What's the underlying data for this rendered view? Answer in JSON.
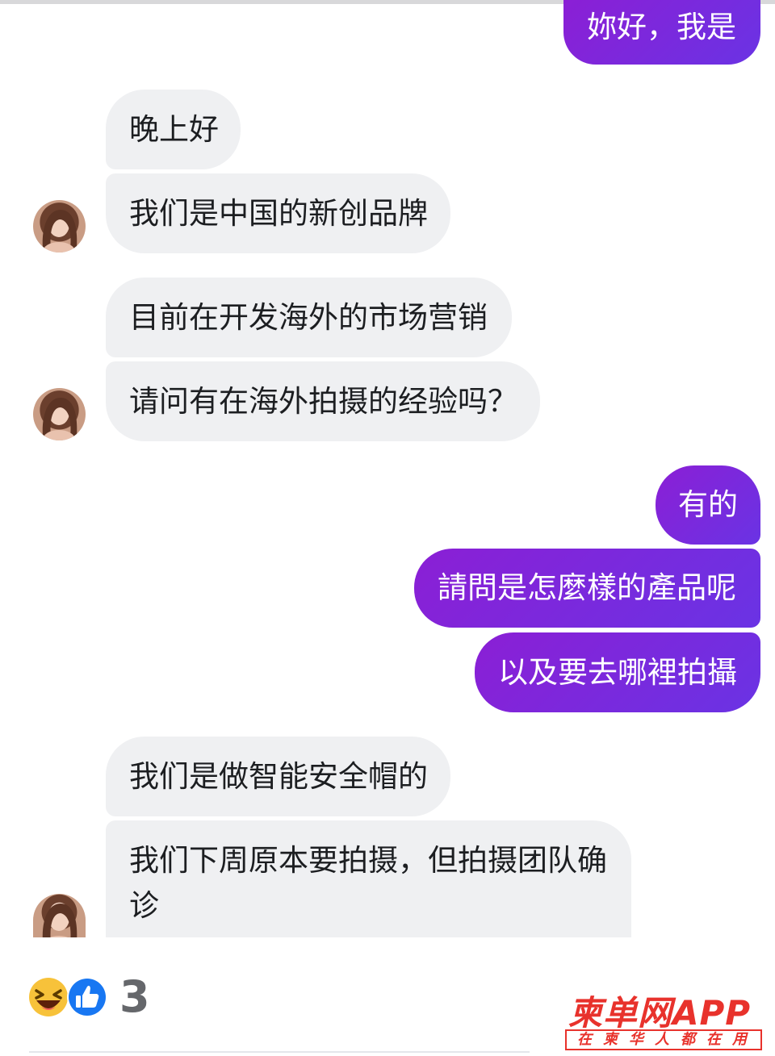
{
  "messages": [
    {
      "side": "out",
      "text": "妳好，我是"
    },
    {
      "side": "in",
      "text": "晚上好"
    },
    {
      "side": "in",
      "text": "我们是中国的新创品牌"
    },
    {
      "side": "in",
      "text": "目前在开发海外的市场营销"
    },
    {
      "side": "in",
      "text": "请问有在海外拍摄的经验吗？"
    },
    {
      "side": "out",
      "text": "有的"
    },
    {
      "side": "out",
      "text": "請問是怎麼樣的產品呢"
    },
    {
      "side": "out",
      "text": "以及要去哪裡拍攝"
    },
    {
      "side": "in",
      "text": "我们是做智能安全帽的"
    },
    {
      "side": "in",
      "line1": "我们下周原本要拍摄，但拍摄团队确",
      "line2": "诊"
    }
  ],
  "reactions": {
    "icons": [
      "laughing-emoji-icon",
      "like-thumbs-up-icon"
    ],
    "count": "3"
  },
  "watermark": {
    "title": "柬单网APP",
    "slogan": "在柬华人都在用"
  },
  "colors": {
    "outgoing_bubble": "#7d22d6",
    "incoming_bubble": "#eff0f2",
    "watermark": "#e8322c"
  }
}
